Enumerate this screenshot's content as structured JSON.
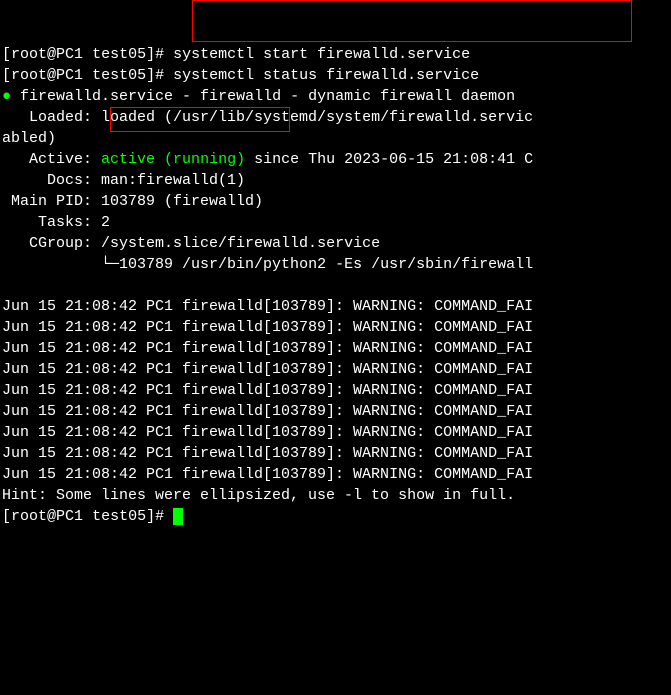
{
  "prompts": [
    {
      "user": "root",
      "host": "PC1",
      "dir": "test05",
      "command": "systemctl start firewalld.service"
    },
    {
      "user": "root",
      "host": "PC1",
      "dir": "test05",
      "command": "systemctl status firewalld.service"
    },
    {
      "user": "root",
      "host": "PC1",
      "dir": "test05",
      "command": ""
    }
  ],
  "status": {
    "header": "firewalld.service - firewalld - dynamic firewall daemon",
    "loaded": "Loaded: loaded (/usr/lib/systemd/system/firewalld.servic",
    "loaded2": "abled)",
    "active_label": "Active:",
    "active_state": "active (running)",
    "active_since": "since Thu 2023-06-15 21:08:41 C",
    "docs": "Docs: man:firewalld(1)",
    "mainpid": "Main PID: 103789 (firewalld)",
    "tasks": "Tasks: 2",
    "cgroup": "CGroup: /system.slice/firewalld.service",
    "cgroup2": "└─103789 /usr/bin/python2 -Es /usr/sbin/firewall"
  },
  "logs": [
    "Jun 15 21:08:42 PC1 firewalld[103789]: WARNING: COMMAND_FAI",
    "Jun 15 21:08:42 PC1 firewalld[103789]: WARNING: COMMAND_FAI",
    "Jun 15 21:08:42 PC1 firewalld[103789]: WARNING: COMMAND_FAI",
    "Jun 15 21:08:42 PC1 firewalld[103789]: WARNING: COMMAND_FAI",
    "Jun 15 21:08:42 PC1 firewalld[103789]: WARNING: COMMAND_FAI",
    "Jun 15 21:08:42 PC1 firewalld[103789]: WARNING: COMMAND_FAI",
    "Jun 15 21:08:42 PC1 firewalld[103789]: WARNING: COMMAND_FAI",
    "Jun 15 21:08:42 PC1 firewalld[103789]: WARNING: COMMAND_FAI",
    "Jun 15 21:08:42 PC1 firewalld[103789]: WARNING: COMMAND_FAI"
  ],
  "hint": "Hint: Some lines were ellipsized, use -l to show in full."
}
